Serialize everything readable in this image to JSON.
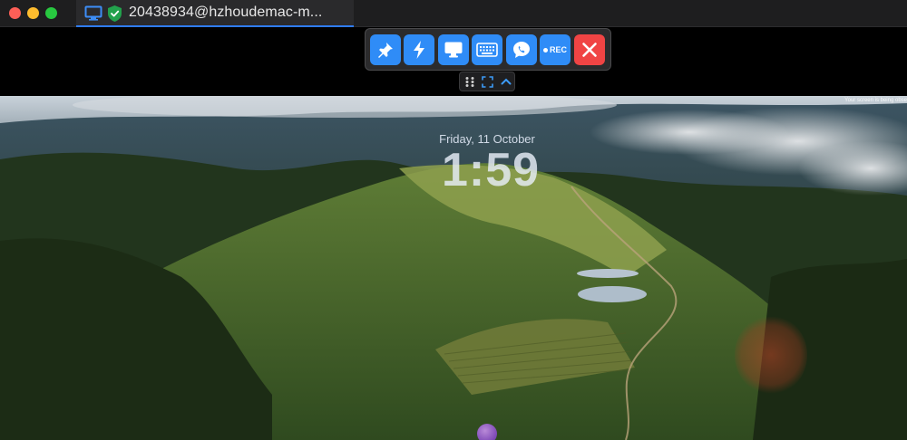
{
  "window": {
    "tab_title": "20438934@hzhoudemac-m...",
    "icons": {
      "monitor": "monitor-icon",
      "shield": "shield-check-icon"
    }
  },
  "toolbar": {
    "buttons": [
      {
        "name": "pin",
        "icon": "pin-icon"
      },
      {
        "name": "lightning",
        "icon": "lightning-icon"
      },
      {
        "name": "display",
        "icon": "monitor-icon"
      },
      {
        "name": "keyboard",
        "icon": "keyboard-icon"
      },
      {
        "name": "chat",
        "icon": "chat-phone-icon"
      },
      {
        "name": "record",
        "label": "REC"
      },
      {
        "name": "close",
        "icon": "close-icon"
      }
    ],
    "colors": {
      "button": "#2f8cf7",
      "close": "#f04444"
    }
  },
  "subbar": {
    "icons": [
      "grid-icon",
      "fullscreen-icon",
      "chevron-up-icon"
    ]
  },
  "remote_screen": {
    "lock_date": "Friday, 11 October",
    "lock_time": "1:59",
    "observed_notice": "Your screen is being obse"
  }
}
